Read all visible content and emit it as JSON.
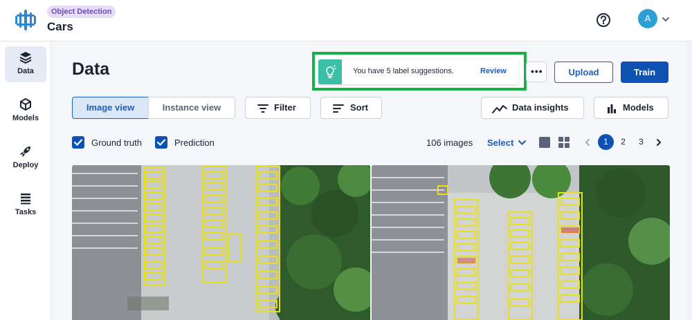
{
  "project": {
    "type_badge": "Object Detection",
    "name": "Cars"
  },
  "user": {
    "avatar_initial": "A"
  },
  "sidebar": {
    "items": [
      {
        "label": "Data",
        "icon": "layers-icon",
        "active": true
      },
      {
        "label": "Models",
        "icon": "cube-icon",
        "active": false
      },
      {
        "label": "Deploy",
        "icon": "rocket-icon",
        "active": false
      },
      {
        "label": "Tasks",
        "icon": "tasks-list-icon",
        "active": false
      }
    ]
  },
  "page": {
    "title": "Data"
  },
  "suggestion": {
    "text": "You have 5 label suggestions.",
    "action": "Review",
    "icon": "lightbulb-icon"
  },
  "header_actions": {
    "more": "•••",
    "upload": "Upload",
    "train": "Train"
  },
  "view_toggle": {
    "image_view": "Image view",
    "instance_view": "Instance view",
    "active": "Image view"
  },
  "toolbar": {
    "filter": "Filter",
    "sort": "Sort",
    "data_insights": "Data insights",
    "models": "Models"
  },
  "filters": {
    "ground_truth": "Ground truth",
    "ground_truth_checked": true,
    "prediction": "Prediction",
    "prediction_checked": true
  },
  "summary": {
    "count": "106 images",
    "select": "Select"
  },
  "pagination": {
    "pages": [
      "1",
      "2",
      "3"
    ],
    "current": "1"
  },
  "colors": {
    "accent": "#0d52b3",
    "highlight_frame": "#18b04a",
    "bbox": "#e8e01c",
    "badge": "#e6dcf8"
  }
}
